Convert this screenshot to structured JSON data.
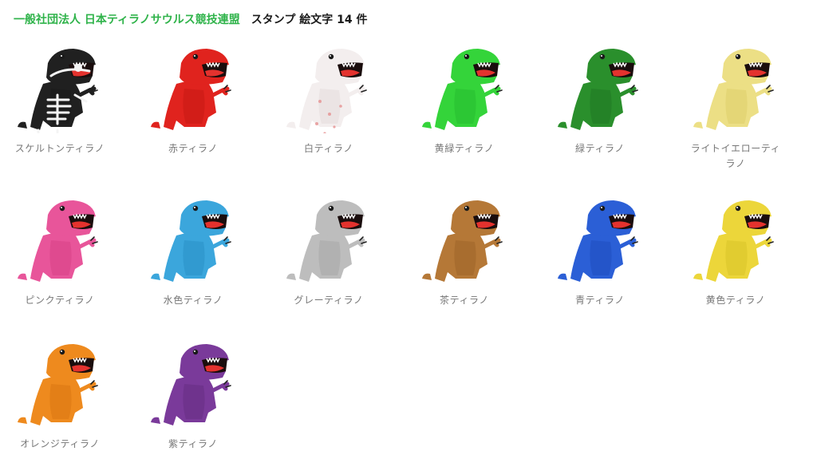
{
  "header": {
    "publisher": "一般社団法人 日本ティラノサウルス競技連盟",
    "title": "スタンプ 絵文字 14 件"
  },
  "items": [
    {
      "label": "スケルトンティラノ",
      "body": "#202020",
      "belly": "#1a1a1a",
      "mark": "skeleton"
    },
    {
      "label": "赤ティラノ",
      "body": "#e0231e",
      "belly": "#c81914"
    },
    {
      "label": "白ティラノ",
      "body": "#f3eeee",
      "belly": "#e6dede",
      "mark": "spots"
    },
    {
      "label": "黄緑ティラノ",
      "body": "#34d43a",
      "belly": "#28be30"
    },
    {
      "label": "緑ティラノ",
      "body": "#2a8f2c",
      "belly": "#227a24"
    },
    {
      "label": "ライトイエローティラノ",
      "body": "#ecdf85",
      "belly": "#e0d16c"
    },
    {
      "label": "ピンクティラノ",
      "body": "#e8559a",
      "belly": "#d94389"
    },
    {
      "label": "水色ティラノ",
      "body": "#3ba6dc",
      "belly": "#2b92c8"
    },
    {
      "label": "グレーティラノ",
      "body": "#bdbdbd",
      "belly": "#a8a8a8"
    },
    {
      "label": "茶ティラノ",
      "body": "#b57837",
      "belly": "#a0662a"
    },
    {
      "label": "青ティラノ",
      "body": "#2b5fd6",
      "belly": "#204ec0"
    },
    {
      "label": "黄色ティラノ",
      "body": "#ecd63a",
      "belly": "#dbc42a"
    },
    {
      "label": "オレンジティラノ",
      "body": "#ee8a1e",
      "belly": "#dc7812"
    },
    {
      "label": "紫ティラノ",
      "body": "#7a3a9a",
      "belly": "#672f85"
    }
  ]
}
